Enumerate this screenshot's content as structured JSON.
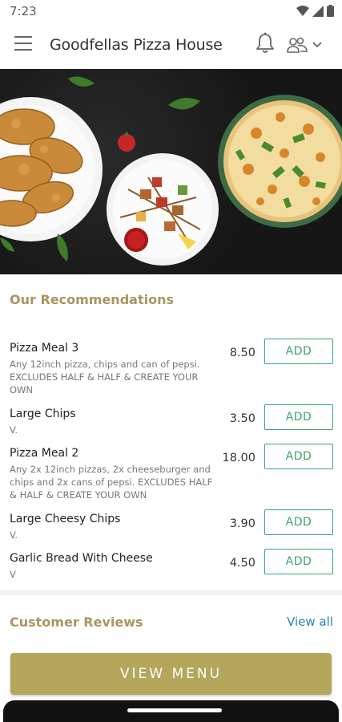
{
  "status_bar": {
    "time": "7:23"
  },
  "app_bar": {
    "title": "Goodfellas Pizza House"
  },
  "recommendations": {
    "title": "Our Recommendations",
    "add_label": "ADD",
    "items": [
      {
        "name": "Pizza Meal 3",
        "desc": "Any 12inch pizza, chips and can of pepsi. EXCLUDES HALF & HALF & CREATE YOUR OWN",
        "price": "8.50"
      },
      {
        "name": "Large Chips",
        "desc": "V.",
        "price": "3.50"
      },
      {
        "name": "Pizza Meal 2",
        "desc": "Any 2x 12inch pizzas, 2x cheeseburger and chips and 2x cans of pepsi. EXCLUDES HALF & HALF & CREATE YOUR OWN",
        "price": "18.00"
      },
      {
        "name": "Large Cheesy Chips",
        "desc": "V.",
        "price": "3.90"
      },
      {
        "name": "Garlic Bread With Cheese",
        "desc": "V",
        "price": "4.50"
      }
    ]
  },
  "reviews": {
    "title": "Customer Reviews",
    "view_all": "View all"
  },
  "cta": {
    "view_menu": "VIEW MENU"
  },
  "colors": {
    "accent_gold": "#b4a65a",
    "add_green": "#3aa56b",
    "link_blue": "#2a7fb8",
    "section_title": "#a89560"
  }
}
